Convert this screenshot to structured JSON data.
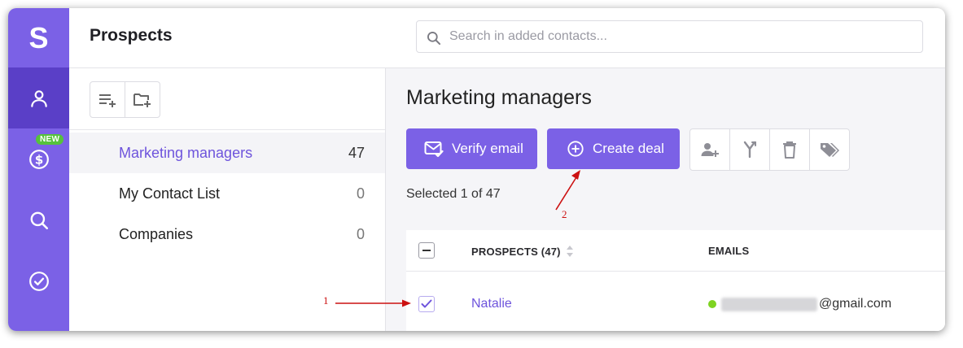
{
  "app": {
    "logo_letter": "S"
  },
  "rail": {
    "items": [
      {
        "icon": "person-icon",
        "active": true
      },
      {
        "icon": "dollar-icon",
        "badge": "NEW"
      },
      {
        "icon": "search-icon"
      },
      {
        "icon": "check-circle-icon"
      }
    ]
  },
  "header": {
    "title": "Prospects",
    "search_placeholder": "Search in added contacts..."
  },
  "lists": {
    "toolbar": {
      "icons": [
        "add-list-icon",
        "add-folder-icon"
      ]
    },
    "items": [
      {
        "name": "Marketing managers",
        "count": "47",
        "active": true
      },
      {
        "name": "My Contact List",
        "count": "0"
      },
      {
        "name": "Companies",
        "count": "0"
      }
    ]
  },
  "main": {
    "title": "Marketing managers",
    "verify_email_label": "Verify email",
    "create_deal_label": "Create deal",
    "action_icons": [
      "add-person-icon",
      "merge-icon",
      "trash-icon",
      "tag-icon"
    ],
    "selected_text": "Selected 1 of 47",
    "table": {
      "columns": {
        "prospects": "PROSPECTS (47)",
        "emails": "EMAILS"
      },
      "rows": [
        {
          "name": "Natalie",
          "email_domain": "@gmail.com",
          "checked": true,
          "status_color": "#7ed321"
        }
      ]
    }
  },
  "annotations": {
    "label_1": "1",
    "label_2": "2",
    "color": "#cc1111"
  },
  "colors": {
    "accent": "#7b61e6",
    "accent_dark": "#5a3fc7",
    "badge": "#56c23b"
  }
}
